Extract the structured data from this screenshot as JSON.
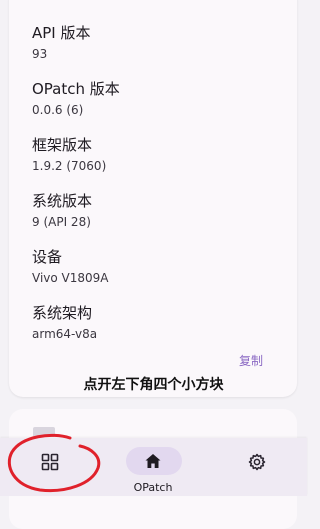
{
  "info": {
    "items": [
      {
        "label": "API 版本",
        "value": "93"
      },
      {
        "label": "OPatch 版本",
        "value": "0.0.6 (6)"
      },
      {
        "label": "框架版本",
        "value": "1.9.2 (7060)"
      },
      {
        "label": "系统版本",
        "value": "9 (API 28)"
      },
      {
        "label": "设备",
        "value": "Vivo V1809A"
      },
      {
        "label": "系统架构",
        "value": "arm64-v8a"
      }
    ],
    "copy_label": "复制"
  },
  "caption": "点开左下角四个小方块",
  "nav": {
    "items": [
      {
        "icon": "grid-icon",
        "label": ""
      },
      {
        "icon": "home-icon",
        "label": "OPatch",
        "selected": true
      },
      {
        "icon": "gear-icon",
        "label": ""
      }
    ]
  },
  "colors": {
    "accent": "#8a68c3",
    "selected_pill": "#e2d8ef",
    "annotation": "#e0212b"
  }
}
